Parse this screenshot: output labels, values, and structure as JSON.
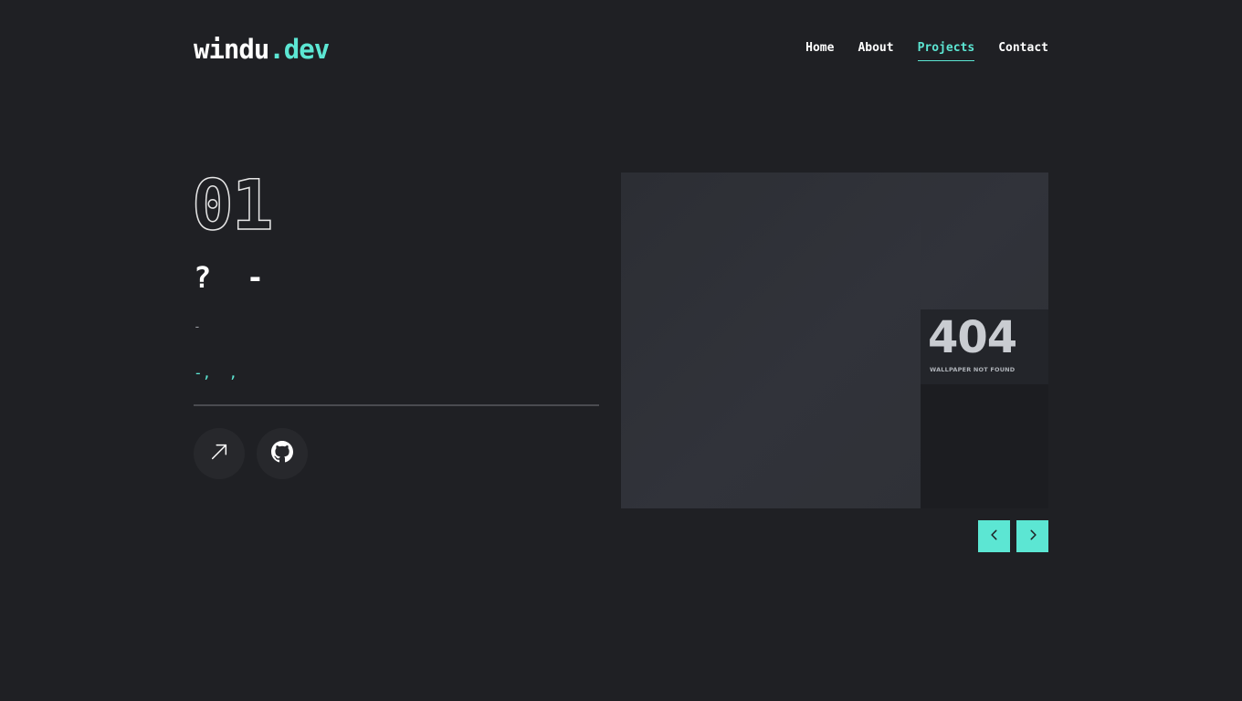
{
  "header": {
    "logo_brand": "windu",
    "logo_tld": ".dev",
    "nav": [
      {
        "label": "Home",
        "active": false
      },
      {
        "label": "About",
        "active": false
      },
      {
        "label": "Projects",
        "active": true
      },
      {
        "label": "Contact",
        "active": false
      }
    ]
  },
  "project": {
    "number": "01",
    "title": "?  -",
    "description": "-",
    "tech": "-,  ,",
    "preview": {
      "code": "404",
      "caption": "WALLPAPER NOT FOUND"
    }
  },
  "colors": {
    "background": "#1f2024",
    "accent": "#5ce6d3",
    "text": "#ffffff",
    "muted": "#9a9ca3",
    "button_bg": "#27282c"
  },
  "icons": {
    "live_link": "arrow-up-right-icon",
    "github": "github-icon",
    "prev": "chevron-left-icon",
    "next": "chevron-right-icon"
  }
}
